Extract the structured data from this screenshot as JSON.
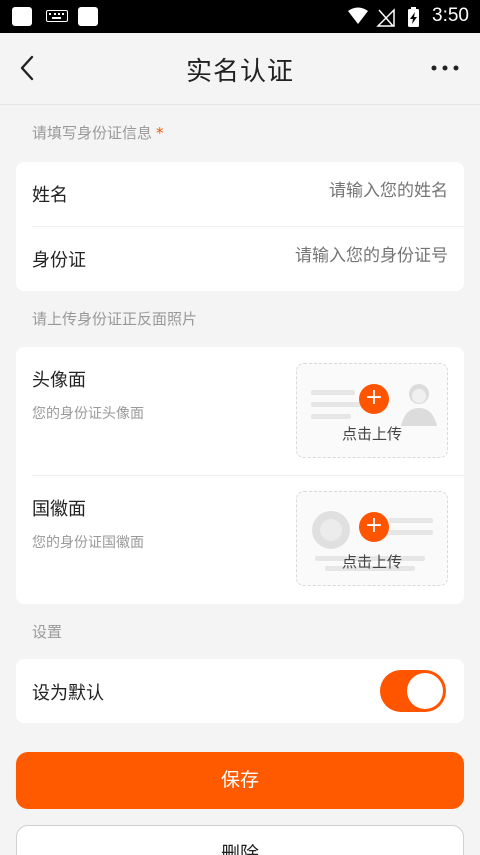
{
  "status_bar": {
    "time": "3:50"
  },
  "header": {
    "title": "实名认证",
    "back_icon": "chevron-left-icon",
    "more_icon": "more-icon"
  },
  "id_section": {
    "label": "请填写身份证信息",
    "required_mark": "*",
    "fields": [
      {
        "label": "姓名",
        "placeholder": "请输入您的姓名"
      },
      {
        "label": "身份证",
        "placeholder": "请输入您的身份证号"
      }
    ]
  },
  "photo_section": {
    "label": "请上传身份证正反面照片",
    "items": [
      {
        "title": "头像面",
        "subtitle": "您的身份证头像面",
        "upload_label": "点击上传",
        "plus": "+"
      },
      {
        "title": "国徽面",
        "subtitle": "您的身份证国徽面",
        "upload_label": "点击上传",
        "plus": "+"
      }
    ]
  },
  "settings_section": {
    "label": "设置",
    "default_label": "设为默认",
    "default_on": true
  },
  "buttons": {
    "save": "保存",
    "delete": "删除"
  },
  "colors": {
    "accent": "#ff5500",
    "background": "#f4f4f4"
  }
}
